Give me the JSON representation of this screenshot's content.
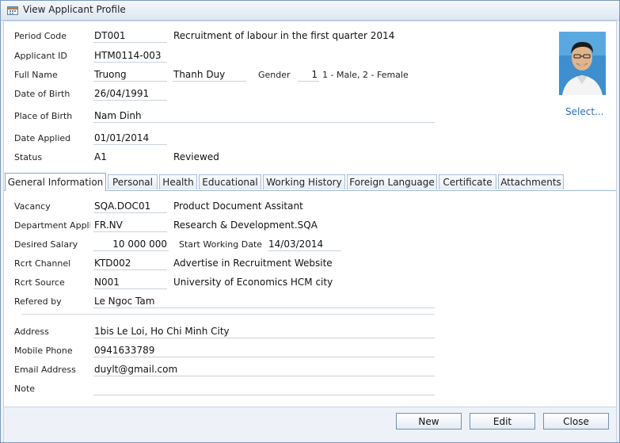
{
  "window": {
    "title": "View Applicant Profile",
    "icon": "calendar-icon"
  },
  "header": {
    "period_code": {
      "label": "Period Code",
      "value": "DT001",
      "desc": "Recruitment of labour in the first quarter 2014"
    },
    "applicant_id": {
      "label": "Applicant ID",
      "value": "HTM0114-003"
    },
    "full_name": {
      "label": "Full Name",
      "last": "Truong",
      "first": "Thanh Duy"
    },
    "gender": {
      "label": "Gender",
      "value": "1",
      "hint": "1 - Male, 2 - Female"
    },
    "dob": {
      "label": "Date of Birth",
      "value": "26/04/1991"
    },
    "pob": {
      "label": "Place of Birth",
      "value": "Nam Dinh"
    },
    "date_applied": {
      "label": "Date Applied",
      "value": "01/01/2014"
    },
    "status": {
      "label": "Status",
      "value": "A1",
      "desc": "Reviewed"
    },
    "photo": {
      "select_label": "Select..."
    }
  },
  "tabs": [
    {
      "label": "General Information",
      "active": true
    },
    {
      "label": "Personal"
    },
    {
      "label": "Health"
    },
    {
      "label": "Educational"
    },
    {
      "label": "Working History"
    },
    {
      "label": "Foreign Language"
    },
    {
      "label": "Certificate"
    },
    {
      "label": "Attachments"
    }
  ],
  "general": {
    "vacancy": {
      "label": "Vacancy",
      "value": "SQA.DOC01",
      "desc": "Product Document Assitant"
    },
    "department": {
      "label": "Department Applied",
      "value": "FR.NV",
      "desc": "Research & Development.SQA"
    },
    "salary": {
      "label": "Desired Salary",
      "value": "10 000 000"
    },
    "start_date": {
      "label": "Start Working Date",
      "value": "14/03/2014"
    },
    "rcrt_channel": {
      "label": "Rcrt Channel",
      "value": "KTD002",
      "desc": "Advertise in Recruitment Website"
    },
    "rcrt_source": {
      "label": "Rcrt Source",
      "value": "N001",
      "desc": "University of Economics HCM city"
    },
    "refered_by": {
      "label": "Refered by",
      "value": "Le Ngoc Tam"
    },
    "address": {
      "label": "Address",
      "value": "1bis Le Loi, Ho Chi Minh City"
    },
    "mobile": {
      "label": "Mobile Phone",
      "value": "0941633789"
    },
    "email": {
      "label": "Email Address",
      "value": "duylt@gmail.com"
    },
    "note": {
      "label": "Note",
      "value": ""
    }
  },
  "buttons": {
    "new": "New",
    "edit": "Edit",
    "close": "Close"
  },
  "colors": {
    "accent": "#2a6fb5",
    "border": "#7a98bd",
    "panel": "#eef2f8"
  }
}
